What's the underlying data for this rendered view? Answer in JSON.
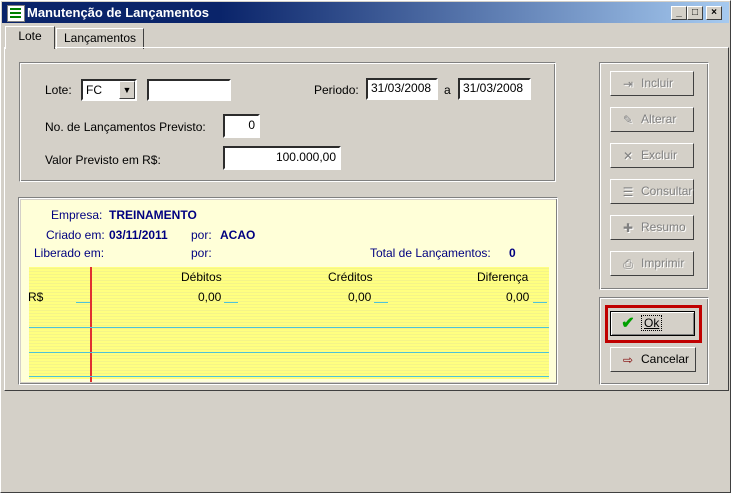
{
  "window": {
    "title": "Manutenção de Lançamentos"
  },
  "tabs": [
    {
      "label": "Lote"
    },
    {
      "label": "Lançamentos"
    }
  ],
  "form": {
    "lote_label": "Lote:",
    "lote_value": "FC",
    "lote_desc": "",
    "periodo_label": "Periodo:",
    "periodo_start": "31/03/2008",
    "periodo_sep": "a",
    "periodo_end": "31/03/2008",
    "nlanc_label": "No. de Lançamentos Previsto:",
    "nlanc_value": "0",
    "valor_label": "Valor Previsto em  R$:",
    "valor_value": "100.000,00"
  },
  "info": {
    "empresa_label": "Empresa:",
    "empresa_value": "TREINAMENTO",
    "criado_label": "Criado em:",
    "criado_value": "03/11/2011",
    "criado_por_label": "por:",
    "criado_por_value": "ACAO",
    "liberado_label": "Liberado em:",
    "liberado_por_label": "por:",
    "total_label": "Total de Lançamentos:",
    "total_value": "0"
  },
  "grid": {
    "headers": [
      "Débitos",
      "Créditos",
      "Diferença"
    ],
    "row_label": "R$",
    "values": [
      "0,00",
      "0,00",
      "0,00"
    ]
  },
  "buttons": {
    "incluir": "Incluir",
    "alterar": "Alterar",
    "excluir": "Excluir",
    "consultar": "Consultar",
    "resumo": "Resumo",
    "imprimir": "Imprimir",
    "ok": "Ok",
    "cancelar": "Cancelar"
  },
  "colors": {
    "title_bar": "#0a246a",
    "highlight": "#c00000",
    "info_text": "#000080",
    "grid_bg": "#ffff80"
  }
}
